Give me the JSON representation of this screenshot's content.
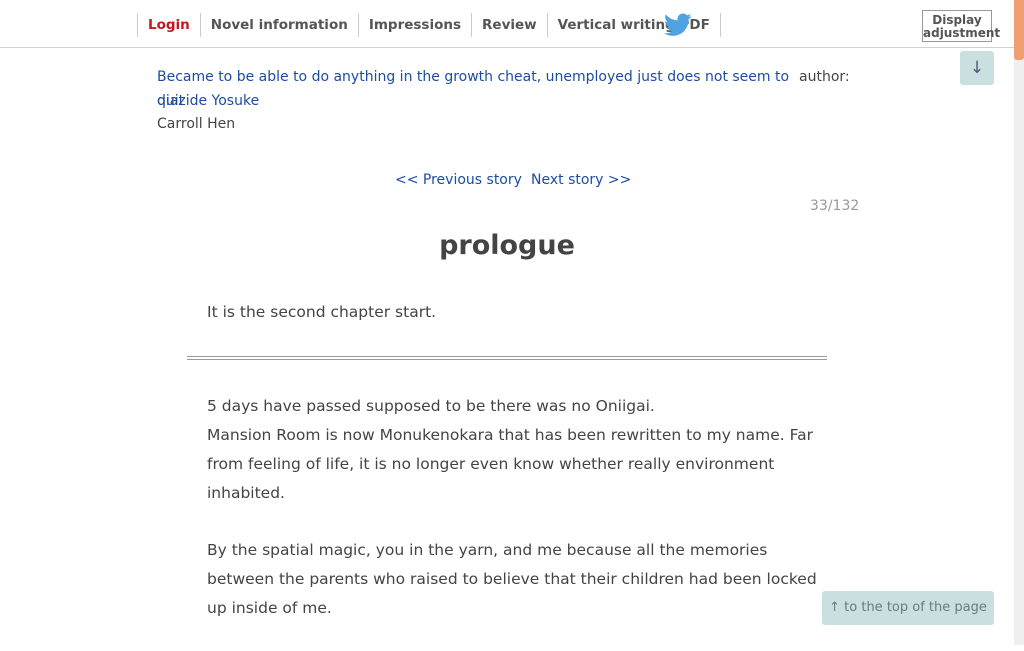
{
  "nav": {
    "items": [
      "Login",
      "Novel information",
      "Impressions",
      "Review",
      "Vertical writing PDF"
    ],
    "twitter_icon": "twitter-bird-icon",
    "display_adjustment": "Display adjustment"
  },
  "colors": {
    "login": "#c5161d",
    "link": "#1b4da4",
    "twitter": "#4fa3e0",
    "float_button": "#c9dfe0"
  },
  "novel": {
    "title": "Became to be able to do anything in the growth cheat, unemployed just does not seem to quit",
    "author_label": "author:",
    "author_name": "diazide Yosuke",
    "chapter": "Carroll Hen"
  },
  "pager": {
    "prev": "<< Previous story",
    "next": "Next story >>",
    "count": "33/132"
  },
  "episode": {
    "title": "prologue",
    "preface": "It is the second chapter start.",
    "paragraphs": [
      [
        "5 days have passed supposed to be there was no Oniigai.",
        "Mansion Room is now Monukenokara that has been rewritten to my name. Far from feeling of life, it is no longer even know whether really environment inhabited."
      ],
      [
        "By the spatial magic, you in the yarn, and me because all the memories between the parents who raised to believe that their children had been locked up inside of me."
      ]
    ]
  },
  "floating": {
    "down_arrow": "↓",
    "to_top": "↑ to the top of the page"
  }
}
